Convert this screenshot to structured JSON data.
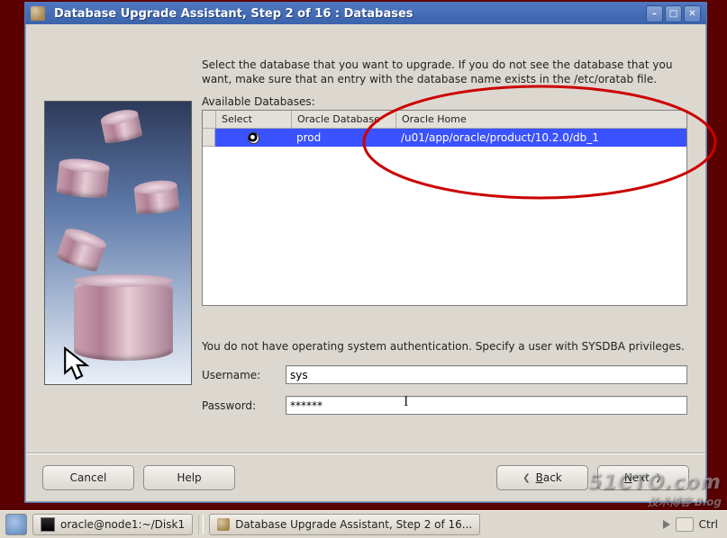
{
  "window": {
    "title": "Database Upgrade Assistant, Step 2 of 16 : Databases"
  },
  "instruction": "Select the database that you want to upgrade. If you do not see the database that you want, make sure that an entry with the database name exists in the /etc/oratab file.",
  "available_label": "Available Databases:",
  "table": {
    "headers": {
      "select": "Select",
      "db": "Oracle Database",
      "home": "Oracle Home"
    },
    "rows": [
      {
        "db": "prod",
        "home": "/u01/app/oracle/product/10.2.0/db_1",
        "selected": true
      }
    ]
  },
  "auth_msg": "You do not have operating system authentication. Specify a user with SYSDBA privileges.",
  "fields": {
    "username_label": "Username:",
    "username_value": "sys",
    "password_label": "Password:",
    "password_value": "******"
  },
  "buttons": {
    "cancel": "Cancel",
    "help": "Help",
    "back": "Back",
    "next": "Next"
  },
  "taskbar": {
    "terminal": "oracle@node1:~/Disk1",
    "app": "Database Upgrade Assistant, Step 2 of 16...",
    "ctrl": "Ctrl"
  },
  "watermark": {
    "main": "51CTO.com",
    "sub": "技术博客  Blog"
  }
}
